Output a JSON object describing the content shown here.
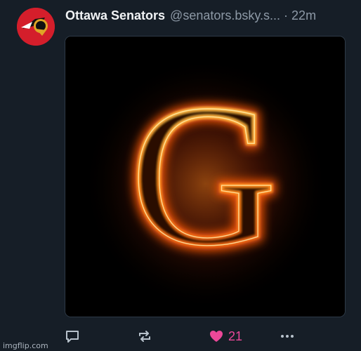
{
  "post": {
    "display_name": "Ottawa Senators",
    "handle": "@senators.bsky.s...",
    "separator": "·",
    "timestamp": "22m",
    "media_glyph": "G",
    "avatar_icon": "senators-logo-icon",
    "actions": {
      "reply_icon": "reply-icon",
      "repost_icon": "repost-icon",
      "like_icon": "heart-icon",
      "like_count": "21",
      "more_icon": "more-icon"
    }
  },
  "watermark": "imgflip.com",
  "colors": {
    "background": "#161e27",
    "accent_like": "#ec4899",
    "muted_text": "#8d99a6",
    "avatar_red": "#d41e2b"
  }
}
